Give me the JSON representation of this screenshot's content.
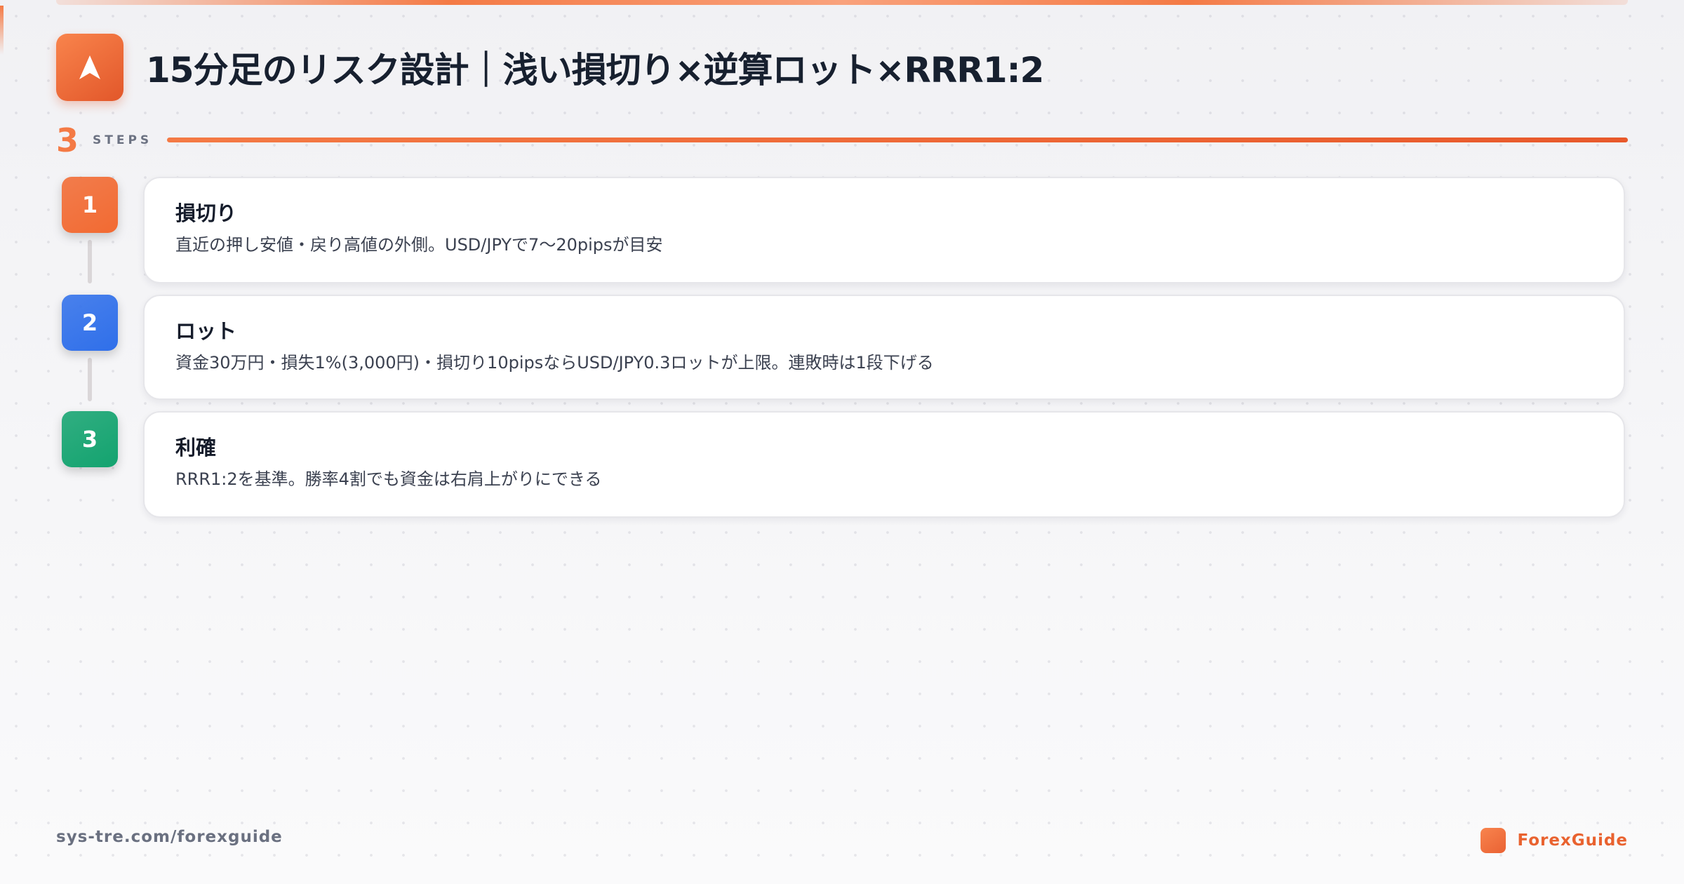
{
  "header": {
    "title": "15分足のリスク設計｜浅い損切り×逆算ロット×RRR1:2",
    "logo_icon": "navigation-arrow-icon"
  },
  "steps_header": {
    "count": "3",
    "label": "STEPS"
  },
  "steps": [
    {
      "number": "1",
      "title": "損切り",
      "description": "直近の押し安値・戻り高値の外側。USD/JPYで7〜20pipsが目安",
      "color": "#f26a32"
    },
    {
      "number": "2",
      "title": "ロット",
      "description": "資金30万円・損失1%(3,000円)・損切り10pipsならUSD/JPY0.3ロットが上限。連敗時は1段下げる",
      "color": "#2f6fea"
    },
    {
      "number": "3",
      "title": "利確",
      "description": "RRR1:2を基準。勝率4割でも資金は右肩上がりにできる",
      "color": "#13a36f"
    }
  ],
  "footer": {
    "url": "sys-tre.com/forexguide",
    "brand": "ForexGuide"
  },
  "colors": {
    "accent": "#f47a45",
    "title": "#17202f"
  }
}
